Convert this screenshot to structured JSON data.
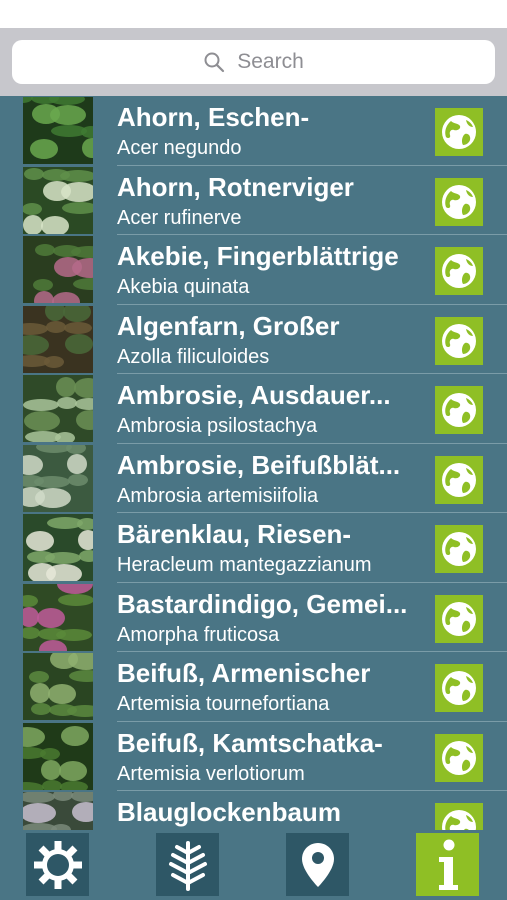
{
  "search": {
    "placeholder": "Search",
    "icon": "search-icon"
  },
  "colors": {
    "accent": "#8fbf25",
    "background": "#4a7585",
    "tab_bg": "#2e5766"
  },
  "plants": [
    {
      "name": "Ahorn, Eschen-",
      "latin": "Acer negundo"
    },
    {
      "name": "Ahorn, Rotnerviger",
      "latin": "Acer rufinerve"
    },
    {
      "name": "Akebie, Fingerblättrige",
      "latin": "Akebia quinata"
    },
    {
      "name": "Algenfarn, Großer",
      "latin": "Azolla filiculoides"
    },
    {
      "name": "Ambrosie, Ausdauer...",
      "latin": "Ambrosia psilostachya"
    },
    {
      "name": "Ambrosie, Beifußblät...",
      "latin": "Ambrosia artemisiifolia"
    },
    {
      "name": "Bärenklau, Riesen-",
      "latin": "Heracleum mantegazzianum"
    },
    {
      "name": "Bastardindigo, Gemei...",
      "latin": "Amorpha fruticosa"
    },
    {
      "name": "Beifuß, Armenischer",
      "latin": "Artemisia tournefortiana"
    },
    {
      "name": "Beifuß, Kamtschatka-",
      "latin": "Artemisia verlotiorum"
    },
    {
      "name": "Blauglockenbaum",
      "latin": ""
    }
  ],
  "tabs": [
    {
      "icon": "gear-icon",
      "active": false
    },
    {
      "icon": "plant-icon",
      "active": false
    },
    {
      "icon": "location-pin-icon",
      "active": false
    },
    {
      "icon": "info-icon",
      "active": true
    }
  ]
}
